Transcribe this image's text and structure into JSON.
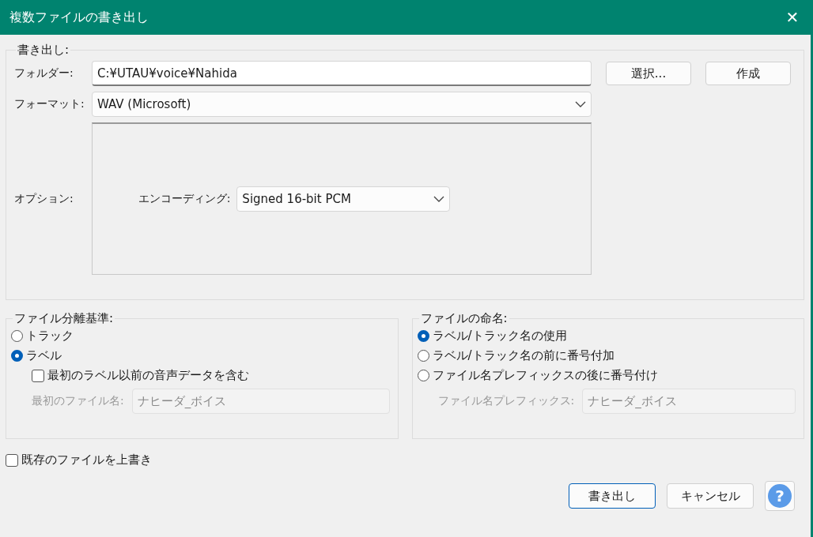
{
  "window": {
    "title": "複数ファイルの書き出し",
    "close": "✕"
  },
  "export_group": {
    "legend": "書き出し:",
    "folder": {
      "label": "フォルダー:",
      "value": "C:¥UTAU¥voice¥Nahida"
    },
    "buttons": [
      "選択...",
      "作成"
    ],
    "format": {
      "label": "フォーマット:",
      "value": "WAV (Microsoft)"
    },
    "options": {
      "label": "オプション:",
      "encoding_label": "エンコーディング:",
      "encoding_value": "Signed 16-bit PCM"
    }
  },
  "split_group": {
    "legend": "ファイル分離基準:",
    "radios": [
      {
        "label": "トラック",
        "selected": false
      },
      {
        "label": "ラベル",
        "selected": true
      }
    ],
    "include_checkbox": {
      "label": "最初のラベル以前の音声データを含む",
      "checked": false
    },
    "first_name": {
      "label": "最初のファイル名:",
      "value": "ナヒーダ_ボイス",
      "disabled": true
    }
  },
  "naming_group": {
    "legend": "ファイルの命名:",
    "radios": [
      {
        "label": "ラベル/トラック名の使用",
        "selected": true
      },
      {
        "label": "ラベル/トラック名の前に番号付加",
        "selected": false
      },
      {
        "label": "ファイル名プレフィックスの後に番号付け",
        "selected": false
      }
    ],
    "prefix": {
      "label": "ファイル名プレフィックス:",
      "value": "ナヒーダ_ボイス",
      "disabled": true
    }
  },
  "overwrite_checkbox": {
    "label": "既存のファイルを上書き",
    "checked": false
  },
  "footer_buttons": [
    {
      "label": "書き出し",
      "kind": "default"
    },
    {
      "label": "キャンセル",
      "kind": "normal"
    },
    {
      "label": "?",
      "kind": "help"
    }
  ]
}
